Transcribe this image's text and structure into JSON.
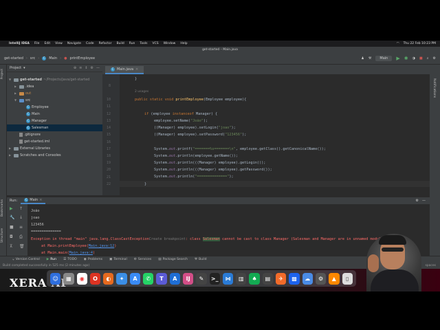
{
  "menubar": {
    "app": "IntelliJ IDEA",
    "items": [
      "File",
      "Edit",
      "View",
      "Navigate",
      "Code",
      "Refactor",
      "Build",
      "Run",
      "Tools",
      "VCS",
      "Window",
      "Help"
    ],
    "datetime": "Thu 22 Feb 10:23 PM"
  },
  "window": {
    "title": "get-started – Main.java"
  },
  "navbar": {
    "crumbs": [
      "get-started",
      "src",
      "Main",
      "printEmployee"
    ],
    "run_config": "Main"
  },
  "left_stripe": {
    "project": "Project",
    "bookmarks": "Bookmarks",
    "structure": "Structure"
  },
  "right_stripe": {
    "notifications": "Notifications"
  },
  "project": {
    "header": "Project",
    "tree": [
      {
        "label": "get-started",
        "hint": "~/Projects/java/get-started",
        "kind": "folder"
      },
      {
        "label": ".idea",
        "kind": "folder"
      },
      {
        "label": "out",
        "kind": "folder-orange"
      },
      {
        "label": "src",
        "kind": "folder-blue"
      },
      {
        "label": "Employee",
        "kind": "class"
      },
      {
        "label": "Main",
        "kind": "class"
      },
      {
        "label": "Manager",
        "kind": "class"
      },
      {
        "label": "Salesman",
        "kind": "class"
      },
      {
        "label": ".gitignore",
        "kind": "file"
      },
      {
        "label": "get-started.iml",
        "kind": "file"
      },
      {
        "label": "External Libraries",
        "kind": "folder"
      },
      {
        "label": "Scratches and Consoles",
        "kind": "folder"
      }
    ]
  },
  "editor": {
    "tab": "Main.java",
    "lines": [
      {
        "num": "8",
        "text": "}"
      },
      {
        "num": "",
        "text": "2 usages"
      },
      {
        "num": "10",
        "text": "public static void printEmployee(Employee employee){"
      },
      {
        "num": "11",
        "text": ""
      },
      {
        "num": "12",
        "text": "if (employee instanceof Manager) {"
      },
      {
        "num": "13",
        "text": "employee.setName(\"João\");"
      },
      {
        "num": "14",
        "text": "((Manager) employee).setLogin(\"joao\");"
      },
      {
        "num": "15",
        "text": "((Manager) employee).setPassword(\"123456\");"
      },
      {
        "num": "16",
        "text": ""
      },
      {
        "num": "17",
        "text": "System.out.printf(\"=======%s=======\\n\", employee.getClass().getCanonicalName());"
      },
      {
        "num": "18",
        "text": "System.out.println(employee.getName());"
      },
      {
        "num": "19",
        "text": "System.out.println(((Manager) employee).getLogin());"
      },
      {
        "num": "20",
        "text": "System.out.println(((Manager) employee).getPassword());"
      },
      {
        "num": "21",
        "text": "System.out.println(\"==============\");"
      },
      {
        "num": "22",
        "text": "}"
      }
    ]
  },
  "run": {
    "header": "Run:",
    "tab": "Main",
    "console": [
      "João",
      "joao",
      "123456",
      "==============",
      "Exception in thread \"main\" java.lang.ClassCastException",
      "at Main.printEmployee(Main.java:12)",
      "at Main.main(Main.java:4)"
    ],
    "exception_rest_a": ": class ",
    "exception_word": "Salesman",
    "exception_rest_b": " cannot be cast to class Manager (Salesman and Manager are in unnamed module o",
    "create_breakpoint": "Create breakpoint",
    "link1": "Main.java:12",
    "link2": "Main.java:4"
  },
  "bottombar": {
    "items": [
      "Version Control",
      "Run",
      "TODO",
      "Problems",
      "Terminal",
      "Services",
      "Package Search",
      "Build"
    ]
  },
  "status": {
    "message": "Build completed successfully in 525 ms (2 minutes ago)",
    "right": "spaces"
  },
  "watermark": "XERA AF",
  "colors": {
    "accent": "#4a88c7",
    "error": "#ff6b68",
    "keyword": "#cc7832",
    "string": "#6a8759"
  }
}
